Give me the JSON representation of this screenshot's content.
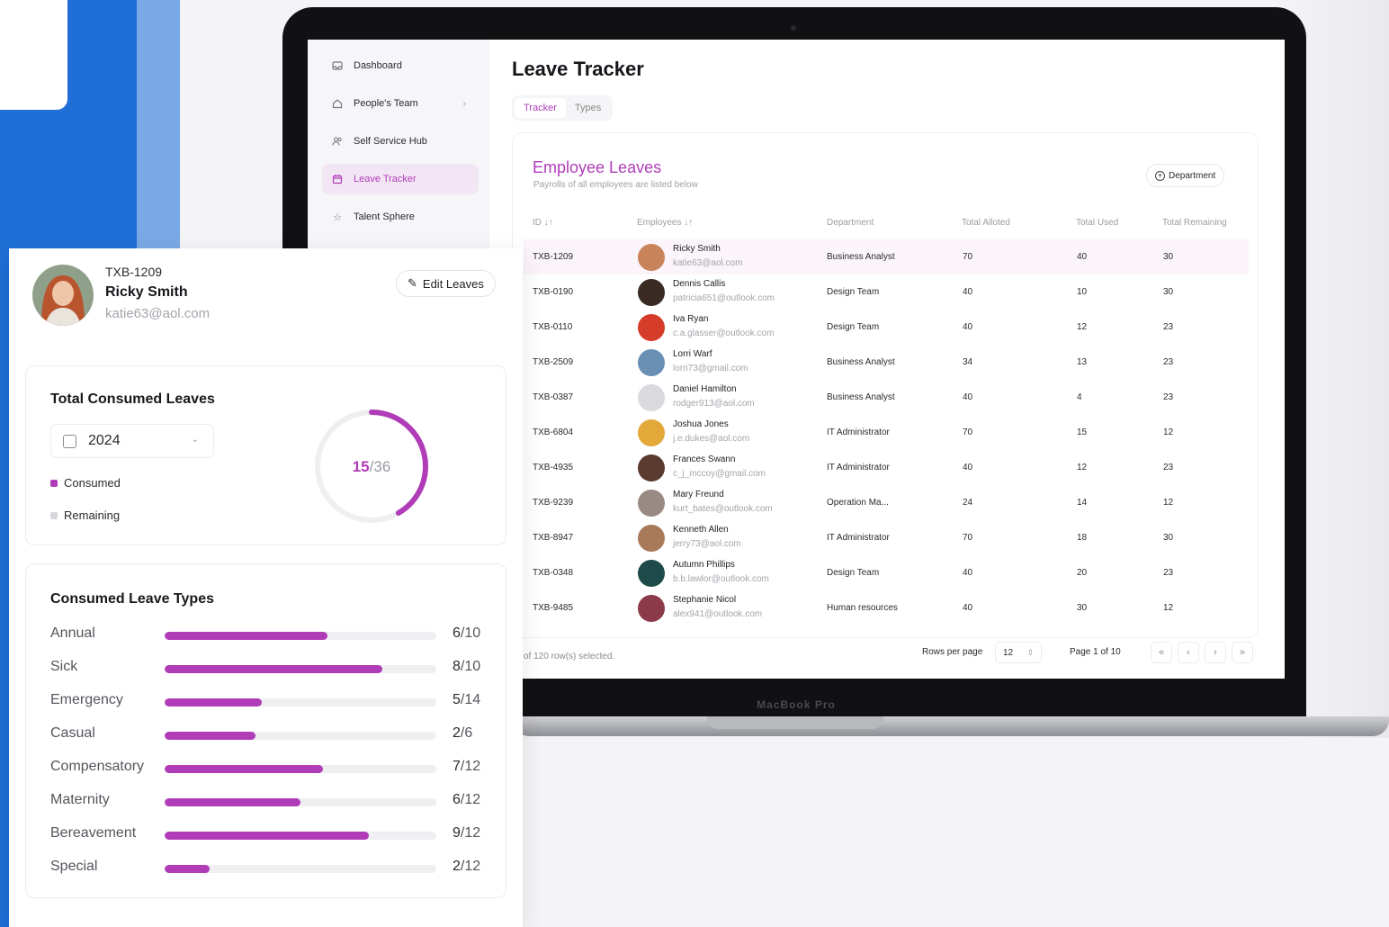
{
  "colors": {
    "accent": "#b03cb8",
    "track": "#efeff2",
    "remaining": "#d6d6dc"
  },
  "laptop": {
    "brand": "MacBook Pro"
  },
  "sidebar": {
    "items": [
      {
        "label": "Dashboard",
        "icon": "inbox-icon"
      },
      {
        "label": "People's Team",
        "icon": "home-icon"
      },
      {
        "label": "Self Service Hub",
        "icon": "users-icon"
      },
      {
        "label": "Leave Tracker",
        "icon": "calendar-icon",
        "active": true
      },
      {
        "label": "Talent Sphere",
        "icon": "star-icon"
      }
    ]
  },
  "main": {
    "title": "Leave Tracker",
    "tabs": [
      {
        "label": "Tracker",
        "active": true
      },
      {
        "label": "Types"
      }
    ],
    "card": {
      "title": "Employee Leaves",
      "subtitle": "Payrolls of all employees are listed below",
      "filter_label": "Department"
    },
    "columns": [
      "ID",
      "Employees",
      "Department",
      "Total Alloted",
      "Total Used",
      "Total Remaining"
    ],
    "rows": [
      {
        "id": "TXB-1209",
        "name": "Ricky Smith",
        "email": "katie63@aol.com",
        "dept": "Business Analyst",
        "alloted": "70",
        "used": "40",
        "remaining": "30",
        "avatar": "#c9835a"
      },
      {
        "id": "TXB-0190",
        "name": "Dennis Callis",
        "email": "patricia651@outlook.com",
        "dept": "Design Team",
        "alloted": "40",
        "used": "10",
        "remaining": "30",
        "avatar": "#3a2a24"
      },
      {
        "id": "TXB-0110",
        "name": "Iva Ryan",
        "email": "c.a.glasser@outlook.com",
        "dept": "Design Team",
        "alloted": "40",
        "used": "12",
        "remaining": "23",
        "avatar": "#d63c2a"
      },
      {
        "id": "TXB-2509",
        "name": "Lorri Warf",
        "email": "lorri73@gmail.com",
        "dept": "Business Analyst",
        "alloted": "34",
        "used": "13",
        "remaining": "23",
        "avatar": "#6a8fb5"
      },
      {
        "id": "TXB-0387",
        "name": "Daniel Hamilton",
        "email": "rodger913@aol.com",
        "dept": "Business Analyst",
        "alloted": "40",
        "used": "4",
        "remaining": "23",
        "avatar": "#d9d9de"
      },
      {
        "id": "TXB-6804",
        "name": "Joshua Jones",
        "email": "j.e.dukes@aol.com",
        "dept": "IT Administrator",
        "alloted": "70",
        "used": "15",
        "remaining": "12",
        "avatar": "#e2a83a"
      },
      {
        "id": "TXB-4935",
        "name": "Frances Swann",
        "email": "c_j_mccoy@gmail.com",
        "dept": "IT Administrator",
        "alloted": "40",
        "used": "12",
        "remaining": "23",
        "avatar": "#5a3a2e"
      },
      {
        "id": "TXB-9239",
        "name": "Mary Freund",
        "email": "kurt_bates@outlook.com",
        "dept": "Operation Ma...",
        "alloted": "24",
        "used": "14",
        "remaining": "12",
        "avatar": "#9a8a84"
      },
      {
        "id": "TXB-8947",
        "name": "Kenneth Allen",
        "email": "jerry73@aol.com",
        "dept": "IT Administrator",
        "alloted": "70",
        "used": "18",
        "remaining": "30",
        "avatar": "#a87a5a"
      },
      {
        "id": "TXB-0348",
        "name": "Autumn Phillips",
        "email": "b.b.lawlor@outlook.com",
        "dept": "Design Team",
        "alloted": "40",
        "used": "20",
        "remaining": "23",
        "avatar": "#1f4a4a"
      },
      {
        "id": "TXB-9485",
        "name": "Stephanie Nicol",
        "email": "alex941@outlook.com",
        "dept": "Human resources",
        "alloted": "40",
        "used": "30",
        "remaining": "12",
        "avatar": "#8a3a4a"
      }
    ],
    "footer": {
      "selection": "of 120 row(s) selected.",
      "rows_per_page_label": "Rows per page",
      "rows_per_page": "12",
      "page_info": "Page 1 of 10",
      "first": "«",
      "prev": "‹",
      "next": "›",
      "last": "»"
    }
  },
  "profile": {
    "id": "TXB-1209",
    "name": "Ricky Smith",
    "email": "katie63@aol.com",
    "edit_label": "Edit Leaves"
  },
  "total_consumed": {
    "title": "Total Consumed Leaves",
    "year": "2024",
    "used": "15",
    "total": "36",
    "total_display": "/36",
    "legend_consumed": "Consumed",
    "legend_remaining": "Remaining"
  },
  "leave_types": {
    "title": "Consumed Leave Types",
    "items": [
      {
        "label": "Annual",
        "used": 6,
        "total": 10,
        "used_text": "6",
        "total_text": "/10"
      },
      {
        "label": "Sick",
        "used": 8,
        "total": 10,
        "used_text": "8",
        "total_text": "/10"
      },
      {
        "label": "Emergency",
        "used": 5,
        "total": 14,
        "used_text": "5",
        "total_text": "/14"
      },
      {
        "label": "Casual",
        "used": 2,
        "total": 6,
        "used_text": "2",
        "total_text": "/6"
      },
      {
        "label": "Compensatory",
        "used": 7,
        "total": 12,
        "used_text": "7",
        "total_text": "/12"
      },
      {
        "label": "Maternity",
        "used": 6,
        "total": 12,
        "used_text": "6",
        "total_text": "/12"
      },
      {
        "label": "Bereavement",
        "used": 9,
        "total": 12,
        "used_text": "9",
        "total_text": "/12"
      },
      {
        "label": "Special",
        "used": 2,
        "total": 12,
        "used_text": "2",
        "total_text": "/12"
      }
    ]
  }
}
